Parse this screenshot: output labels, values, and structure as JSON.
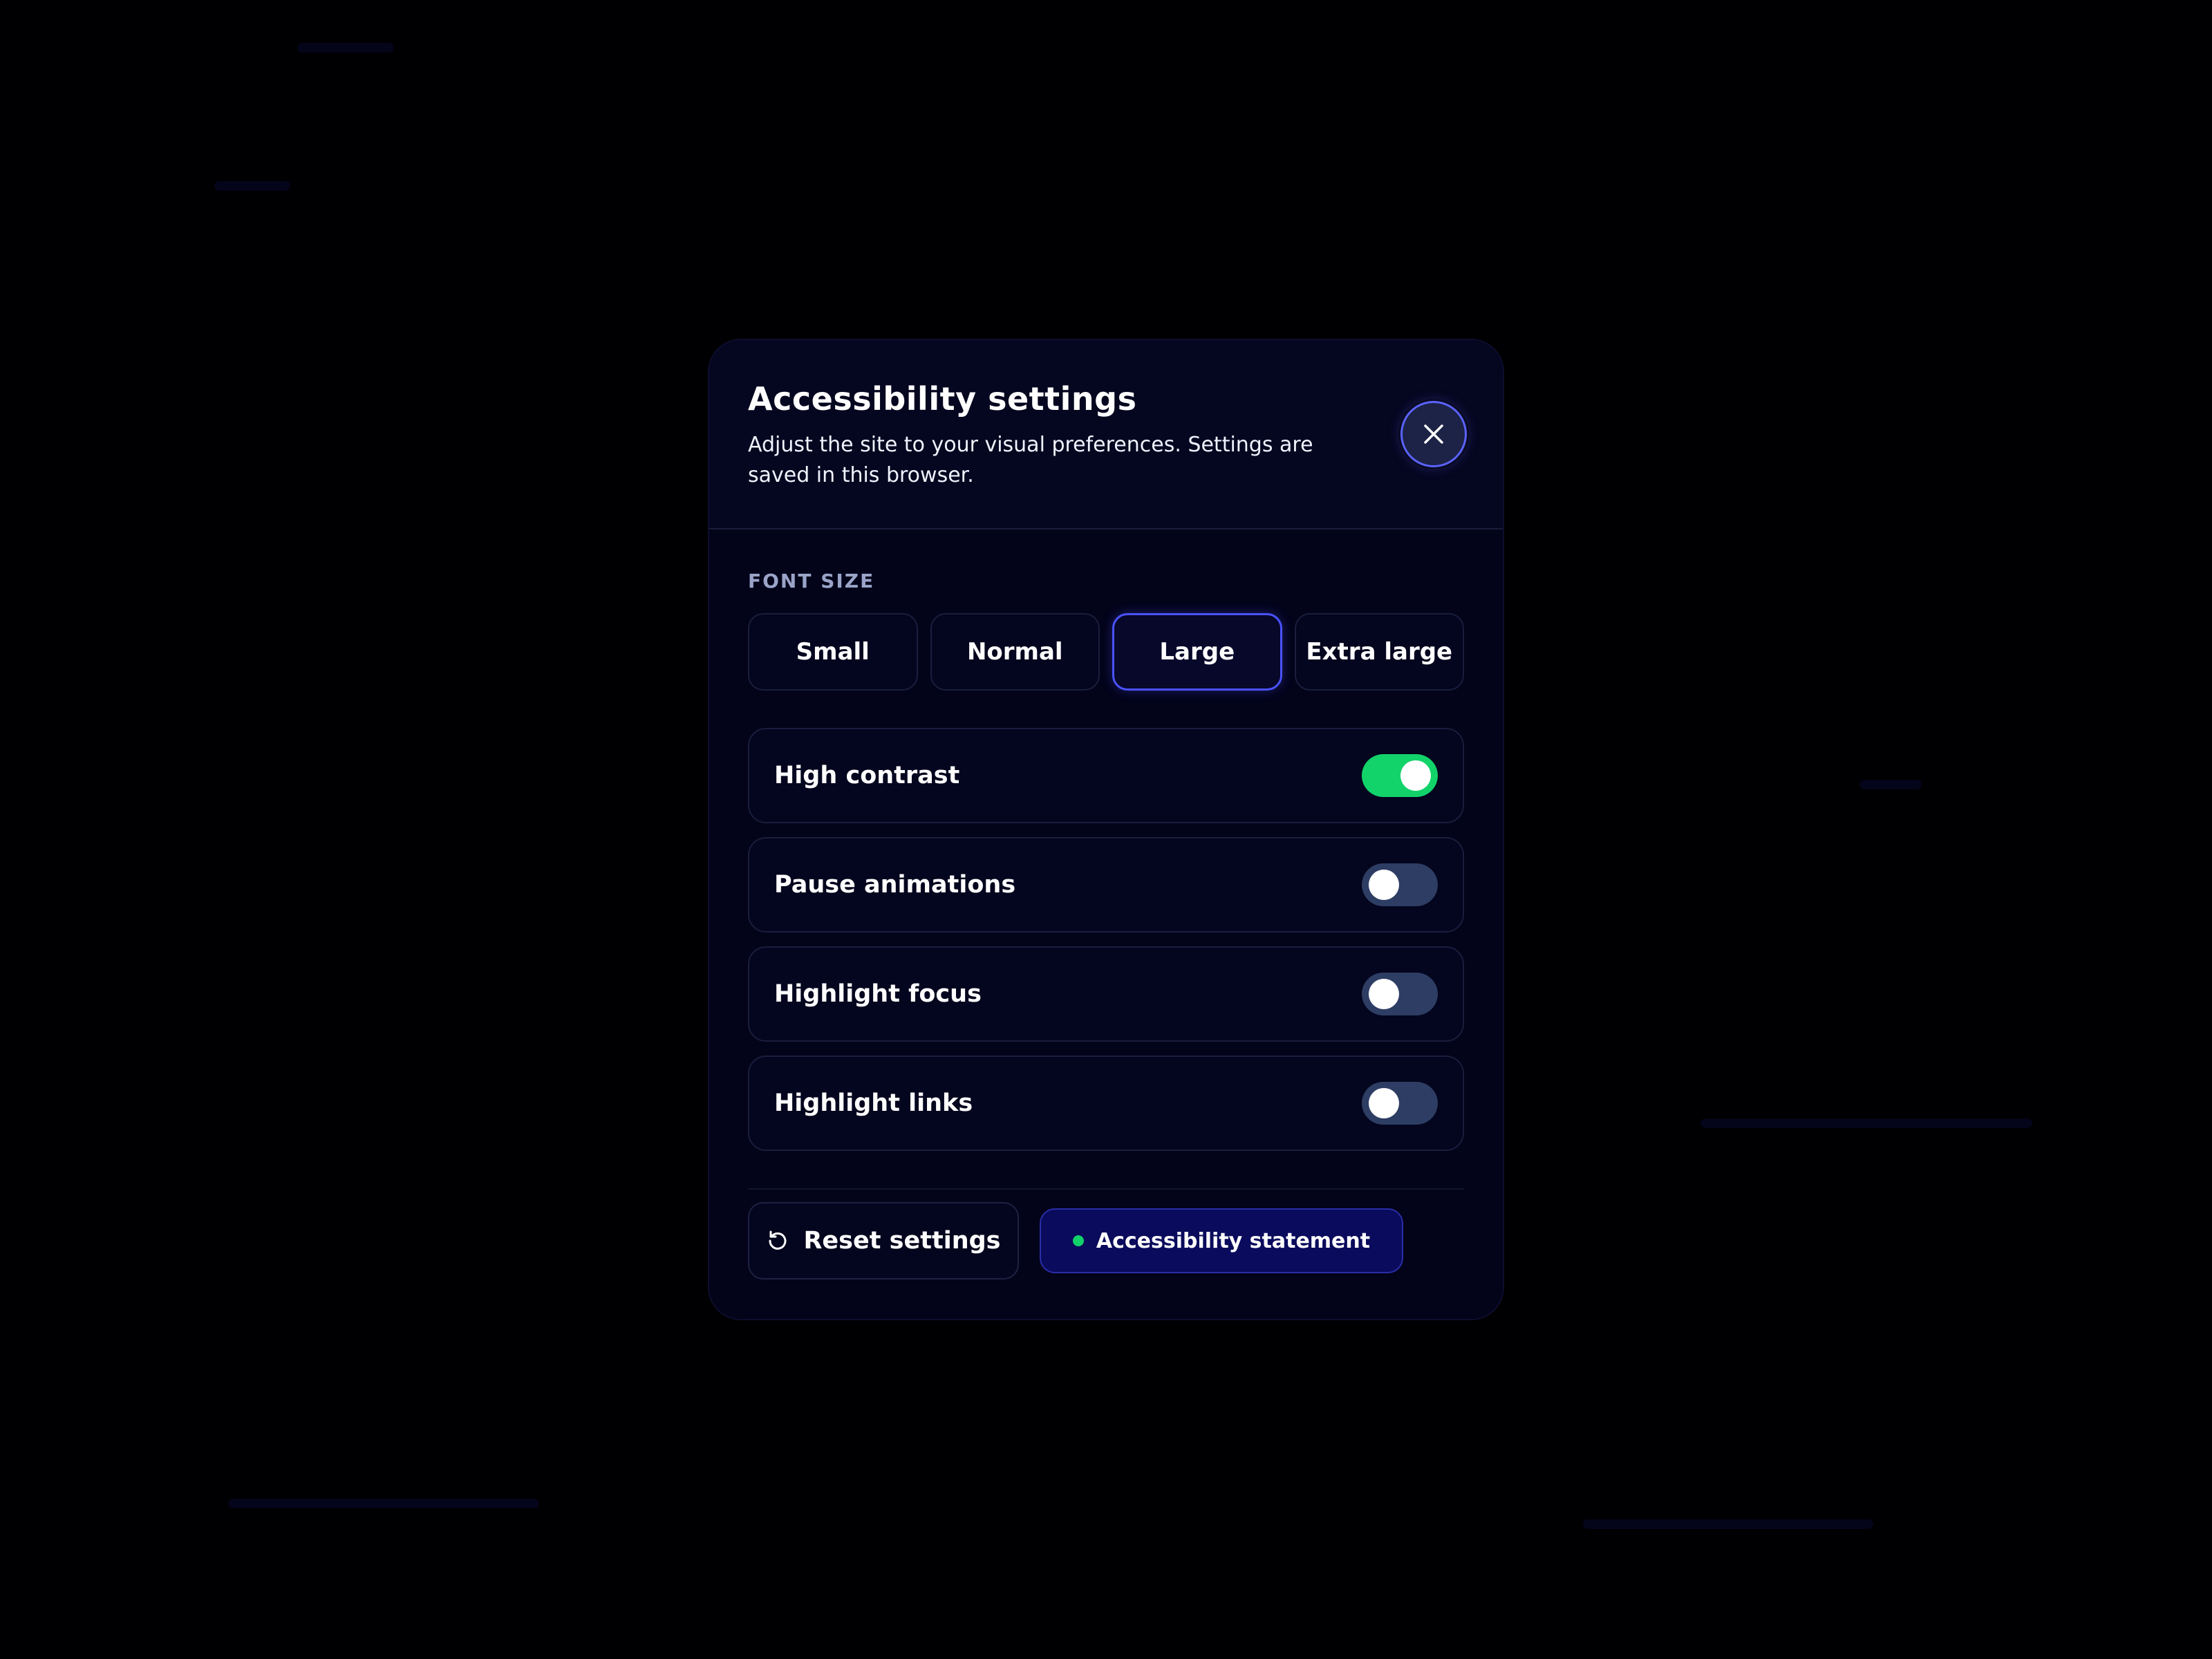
{
  "dialog": {
    "title": "Accessibility settings",
    "subtitle": "Adjust the site to your visual preferences. Settings are saved in this browser.",
    "close_icon": "close-icon"
  },
  "font_size": {
    "label": "FONT SIZE",
    "options": [
      "Small",
      "Normal",
      "Large",
      "Extra large"
    ],
    "selected": "Large"
  },
  "toggles": [
    {
      "label": "High contrast",
      "on": true
    },
    {
      "label": "Pause animations",
      "on": false
    },
    {
      "label": "Highlight focus",
      "on": false
    },
    {
      "label": "Highlight links",
      "on": false
    }
  ],
  "footer": {
    "reset_label": "Reset settings",
    "reset_icon": "reset-icon",
    "statement_label": "Accessibility statement"
  },
  "colors": {
    "accent": "#4a52ff",
    "toggle_on": "#12d36a",
    "toggle_off": "#2d3d63",
    "statement_bg": "#0a0b5c"
  }
}
